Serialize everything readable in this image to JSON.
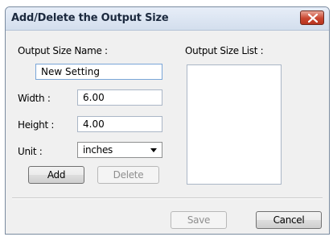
{
  "dialog": {
    "title": "Add/Delete the Output Size",
    "output_size_name_label": "Output Size Name :",
    "output_size_name_value": "New Setting",
    "width_label": "Width :",
    "width_value": "6.00",
    "height_label": "Height :",
    "height_value": "4.00",
    "unit_label": "Unit :",
    "unit_value": "inches",
    "add_label": "Add",
    "delete_label": "Delete",
    "output_size_list_label": "Output Size List :",
    "output_size_list_items": [],
    "save_label": "Save",
    "cancel_label": "Cancel"
  },
  "icons": {
    "close": "close-icon",
    "dropdown": "chevron-down-icon"
  },
  "colors": {
    "close_button": "#c9452f",
    "dialog_background": "#f0f0f0",
    "title_bar": "#d3deed"
  }
}
